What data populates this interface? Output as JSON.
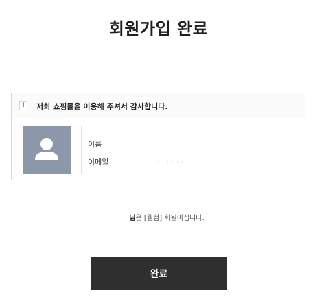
{
  "page": {
    "title": "회원가입 완료"
  },
  "notice": {
    "icon": "alert-icon",
    "icon_glyph": "!",
    "text": "저희 쇼핑몰을 이용해 주셔서 감사합니다."
  },
  "member": {
    "avatar_icon": "user-silhouette-icon",
    "name_label": "이름",
    "email_label": "이메일",
    "email_value": "· · · ·  · ·"
  },
  "welcome": {
    "name_suffix": "님",
    "message": "은 [웰컴] 회원이십니다."
  },
  "actions": {
    "done_label": "완료"
  },
  "colors": {
    "button_bg": "#2f2f2f",
    "avatar_bg": "#8d97aa",
    "alert_red": "#d0302b"
  }
}
